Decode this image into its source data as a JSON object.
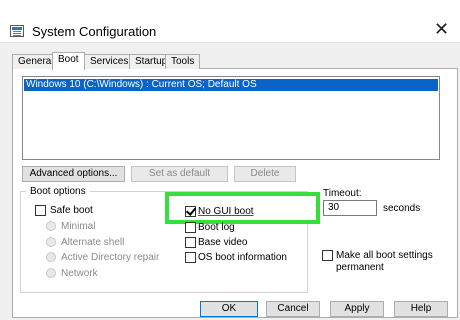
{
  "window": {
    "title": "System Configuration",
    "close_glyph": "✕"
  },
  "tabs": [
    "General",
    "Boot",
    "Services",
    "Startup",
    "Tools"
  ],
  "active_tab": "Boot",
  "os_list": {
    "entries": [
      "Windows 10 (C:\\Windows) : Current OS; Default OS"
    ],
    "selected_index": 0
  },
  "list_buttons": {
    "advanced": "Advanced options...",
    "set_default": "Set as default",
    "delete": "Delete"
  },
  "boot_options": {
    "legend": "Boot options",
    "safe_boot": {
      "label": "Safe boot",
      "checked": false
    },
    "safe_modes": [
      "Minimal",
      "Alternate shell",
      "Active Directory repair",
      "Network"
    ],
    "no_gui_boot": {
      "label": "No GUI boot",
      "checked": true
    },
    "boot_log": {
      "label": "Boot log",
      "checked": false
    },
    "base_video": {
      "label": "Base video",
      "checked": false
    },
    "os_boot_information": {
      "label": "OS boot information",
      "checked": false
    }
  },
  "timeout": {
    "label": "Timeout:",
    "value": "30",
    "unit": "seconds"
  },
  "make_permanent": {
    "line1": "Make all boot settings",
    "line2": "permanent",
    "checked": false
  },
  "dialog_buttons": {
    "ok": "OK",
    "cancel": "Cancel",
    "apply": "Apply",
    "help": "Help"
  },
  "colors": {
    "selection": "#0a64c8",
    "highlight_box": "#35e03a",
    "primary_button_border": "#0078d7"
  }
}
